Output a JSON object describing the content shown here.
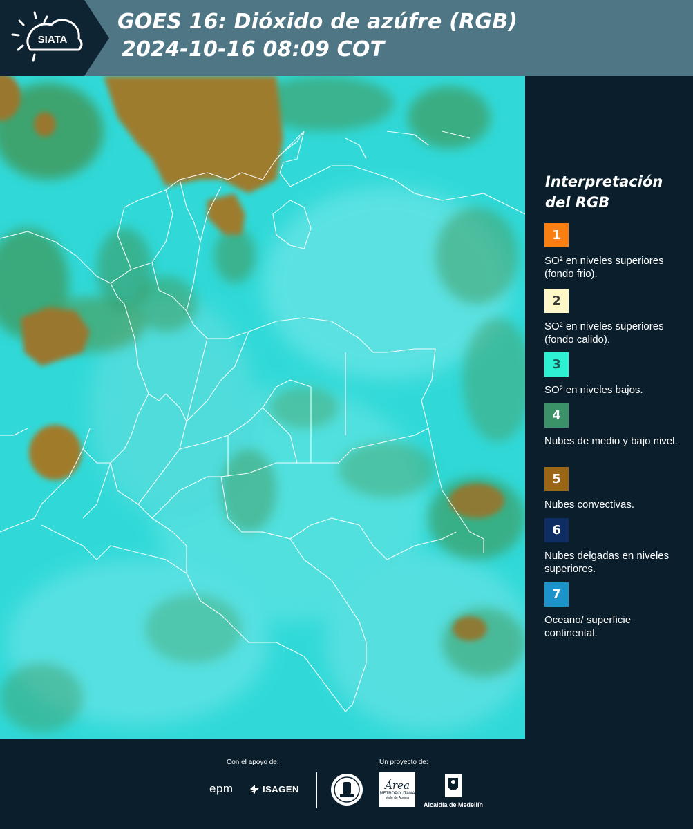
{
  "header": {
    "logo_text": "SIATA",
    "title_line1": "GOES 16: Dióxido de azúfre (RGB)",
    "title_line2": " 2024-10-16 08:09 COT"
  },
  "legend": {
    "title": "Interpretación del RGB",
    "items": [
      {
        "number": "1",
        "label": "SO² en niveles superiores (fondo frio).",
        "color": "#f97f13",
        "text_color": "#ffffff"
      },
      {
        "number": "2",
        "label": "SO² en niveles superiores (fondo calido).",
        "color": "#fef8c8",
        "text_color": "#3a3a3a"
      },
      {
        "number": "3",
        "label": "SO² en niveles bajos.",
        "color": "#2ef0d3",
        "text_color": "#1d5a58"
      },
      {
        "number": "4",
        "label": "Nubes de medio y bajo nivel.",
        "color": "#3b9268",
        "text_color": "#ffffff"
      },
      {
        "number": "5",
        "label": "Nubes convectivas.",
        "color": "#9a6616",
        "text_color": "#ffffff"
      },
      {
        "number": "6",
        "label": "Nubes delgadas en niveles superiores.",
        "color": "#0e2d63",
        "text_color": "#ffffff"
      },
      {
        "number": "7",
        "label": "Oceano/ superficie continental.",
        "color": "#1c93c9",
        "text_color": "#ffffff"
      }
    ]
  },
  "footer": {
    "support_label": "Con el apoyo de:",
    "project_label": "Un proyecto de:",
    "support_partners": [
      "epm",
      "ISAGEN"
    ],
    "project_partners": [
      "METROPOLITANA",
      "Valle de Aburrá",
      "Alcaldía de Medellín"
    ],
    "area_logo_text": "Área"
  },
  "colors": {
    "background": "#0b1e2b",
    "header_band": "#4e7684",
    "map_base": "#2ed8d6",
    "convective": "#9a7b2e",
    "low_clouds": "#3f9a5e"
  }
}
